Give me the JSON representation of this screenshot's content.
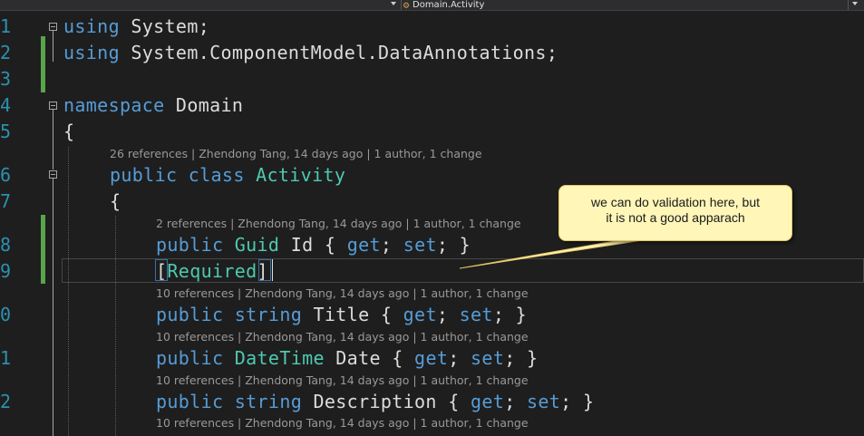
{
  "nav_bar": {
    "member_label": "Domain.Activity",
    "member_icon": "class-icon"
  },
  "editor": {
    "line_numbers": [
      "1",
      "2",
      "3",
      "4",
      "5",
      "6",
      "7",
      "8",
      "9",
      "0",
      "1",
      "2"
    ],
    "lines": {
      "l1": {
        "kw": "using",
        "rest": " System;"
      },
      "l2": {
        "kw": "using",
        "rest": " System.ComponentModel.DataAnnotations;"
      },
      "l4": {
        "kw": "namespace",
        "rest": " Domain"
      },
      "l5": {
        "text": "{"
      },
      "l6": {
        "kw1": "public",
        "kw2": " class",
        "type": " Activity"
      },
      "l7": {
        "text": "{"
      },
      "l8": {
        "kw": "public",
        "type": " Guid",
        "name": " Id",
        "open": " { ",
        "get": "get",
        "sep": "; ",
        "set": "set",
        "close": "; }"
      },
      "l9": {
        "open_bracket": "[",
        "attr": "Required",
        "close_bracket": "]"
      },
      "l10": {
        "kw": "public",
        "type": " string",
        "name": " Title",
        "open": " { ",
        "get": "get",
        "sep": "; ",
        "set": "set",
        "close": "; }"
      },
      "l11": {
        "kw": "public",
        "type": " DateTime",
        "name": " Date",
        "open": " { ",
        "get": "get",
        "sep": "; ",
        "set": "set",
        "close": "; }"
      },
      "l12": {
        "kw": "public",
        "type": " string",
        "name": " Description",
        "open": " { ",
        "get": "get",
        "sep": "; ",
        "set": "set",
        "close": "; }"
      }
    },
    "codelens": {
      "class": "26 references | Zhendong Tang, 14 days ago | 1 author, 1 change",
      "id": "2 references | Zhendong Tang, 14 days ago | 1 author, 1 change",
      "title": "10 references | Zhendong Tang, 14 days ago | 1 author, 1 change",
      "date": "10 references | Zhendong Tang, 14 days ago | 1 author, 1 change",
      "description": "10 references | Zhendong Tang, 14 days ago | 1 author, 1 change",
      "next": "10 references | Zhendong Tang, 14 days ago | 1 author, 1 change"
    }
  },
  "callout": {
    "line1": "we can do validation here, but",
    "line2": "it is not a good apparach"
  },
  "colors": {
    "background": "#1e1e1e",
    "keyword": "#569cd6",
    "type": "#4ec9b0",
    "line_number": "#2b91af",
    "change_bar": "#57a64a",
    "callout_fill": "#fff6b8"
  }
}
